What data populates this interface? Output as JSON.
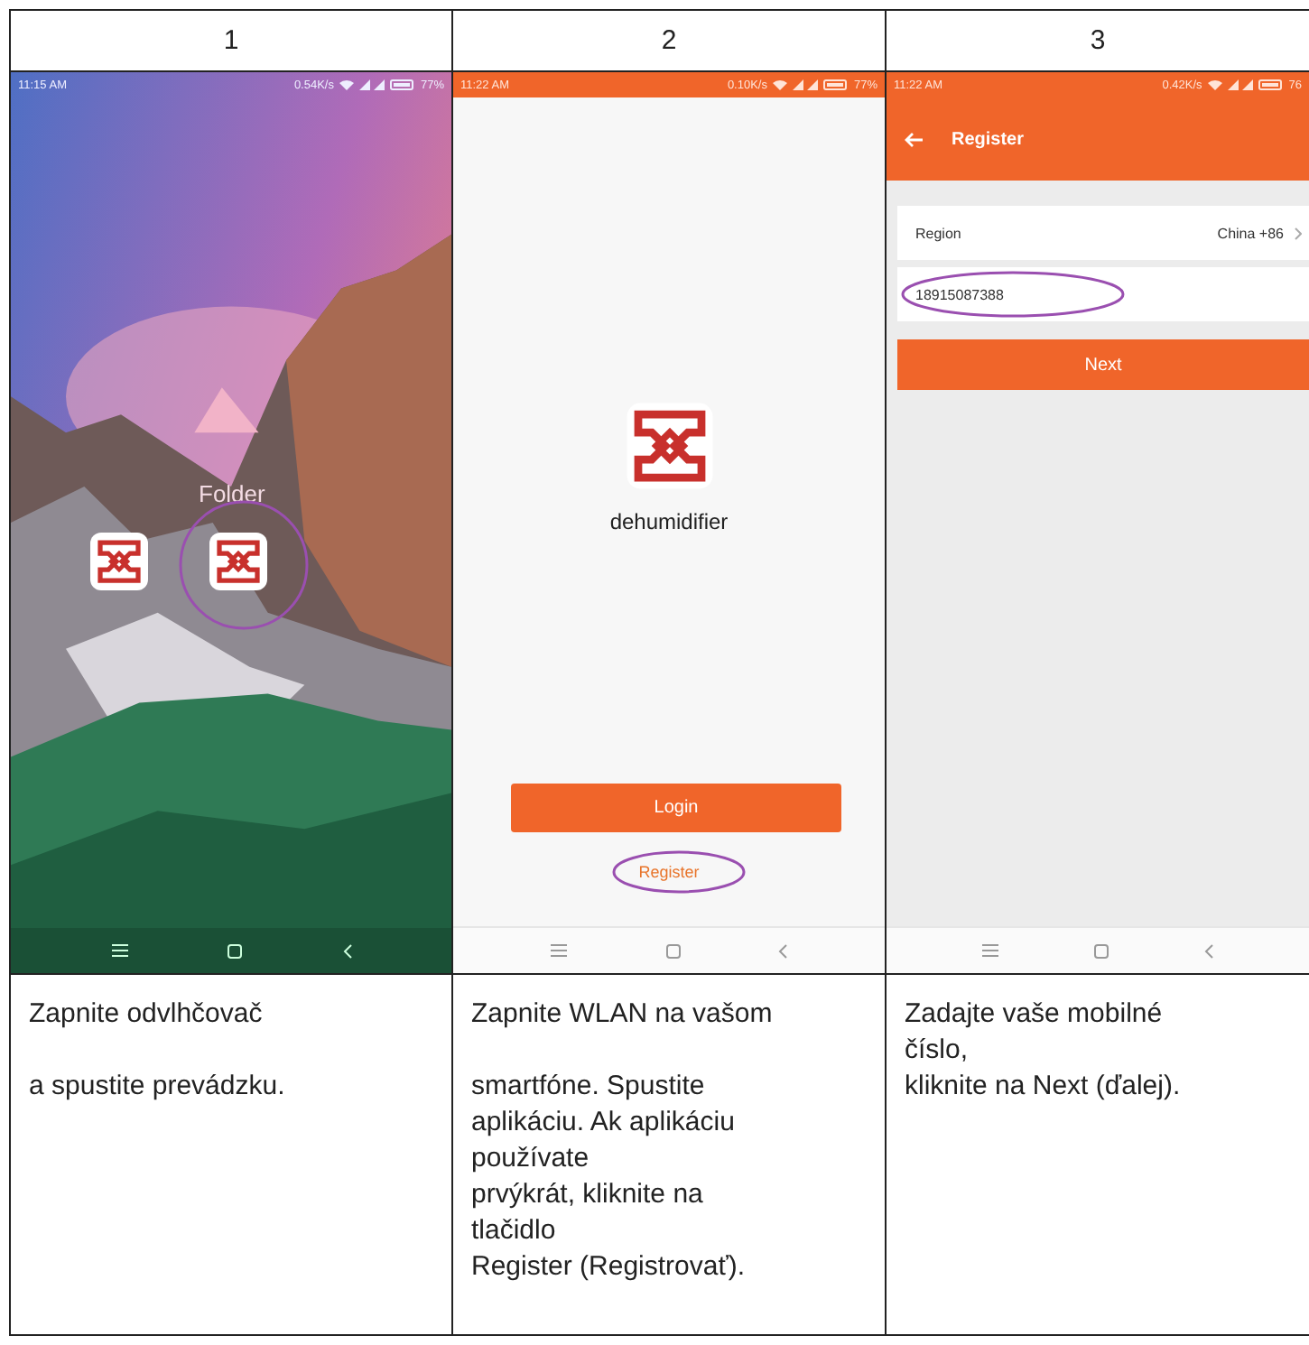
{
  "columns": [
    {
      "number": "1",
      "screen": {
        "kind": "home",
        "status_bar": {
          "time": "11:15 AM",
          "speed": "0.54K/s",
          "battery": "77%"
        },
        "folder_label": "Folder",
        "apps": [
          {
            "kind": "app"
          },
          {
            "kind": "app"
          }
        ],
        "last_app_circled": true
      },
      "caption": [
        [
          "Zapnite odvlhčovač"
        ],
        [
          "a spustite prevádzku."
        ]
      ]
    },
    {
      "number": "2",
      "screen": {
        "kind": "login",
        "status_bar": {
          "time": "11:22 AM",
          "speed": "0.10K/s",
          "battery": "77%"
        },
        "app_name": "dehumidifier",
        "login_button": "Login",
        "register_link": "Register",
        "register_highlighted": true
      },
      "caption": [
        [
          "Zapnite WLAN na vašom"
        ],
        [
          "smartfóne. Spustite",
          "aplikáciu. Ak aplikáciu",
          "používate",
          "prvýkrát, kliknite na",
          "tlačidlo",
          "Register (Registrovať)."
        ]
      ]
    },
    {
      "number": "3",
      "screen": {
        "kind": "register",
        "status_bar": {
          "time": "11:22 AM",
          "speed": "0.42K/s",
          "battery": "76"
        },
        "title": "Register",
        "region_label": "Region",
        "region_value": "China +86",
        "phone": "18915087388",
        "phone_highlighted": true,
        "next_button": "Next"
      },
      "caption": [
        [
          "Zadajte vaše mobilné",
          "číslo,",
          "kliknite na Next (ďalej)."
        ]
      ]
    }
  ]
}
